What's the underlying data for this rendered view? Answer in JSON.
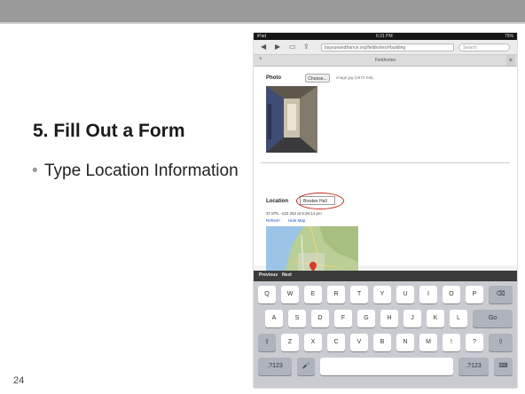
{
  "slide": {
    "title": "5. Fill Out a Form",
    "bullet_marker": "•",
    "bullet": "Type Location Information",
    "page_number": "24"
  },
  "ipad": {
    "status": {
      "carrier": "iPad",
      "time": "6:31 PM",
      "battery": "75%"
    },
    "url": "baysueandfrance.org/fieldnotes/#building",
    "search_placeholder": "Search",
    "tab_title": "Fieldnotes",
    "form": {
      "photo_label": "Photo",
      "choose_button": "Choose...",
      "file_name": "image.jpg (1972 KiB)",
      "location_label": "Location",
      "location_value": "Bowker Hall",
      "coordinates": "37.875, -122.263 at 6:26:14 pm",
      "refresh_link": "Refresh",
      "hide_map_link": "Hide Map"
    },
    "keyboard_toolbar": {
      "previous": "Previous",
      "next": "Next"
    },
    "keyboard_rows": [
      [
        "Q",
        "W",
        "E",
        "R",
        "T",
        "Y",
        "U",
        "I",
        "O",
        "P",
        "⌫"
      ],
      [
        "A",
        "S",
        "D",
        "F",
        "G",
        "H",
        "J",
        "K",
        "L",
        "Go"
      ],
      [
        "⇧",
        "Z",
        "X",
        "C",
        "V",
        "B",
        "N",
        "M",
        "!",
        "?",
        "⇧"
      ],
      [
        ".?123",
        "🎤",
        "",
        ".?123",
        "⌨"
      ]
    ]
  },
  "colors": {
    "header_bar": "#9a9a9a",
    "annotation_circle": "#c62b1c",
    "link": "#2155c6"
  }
}
